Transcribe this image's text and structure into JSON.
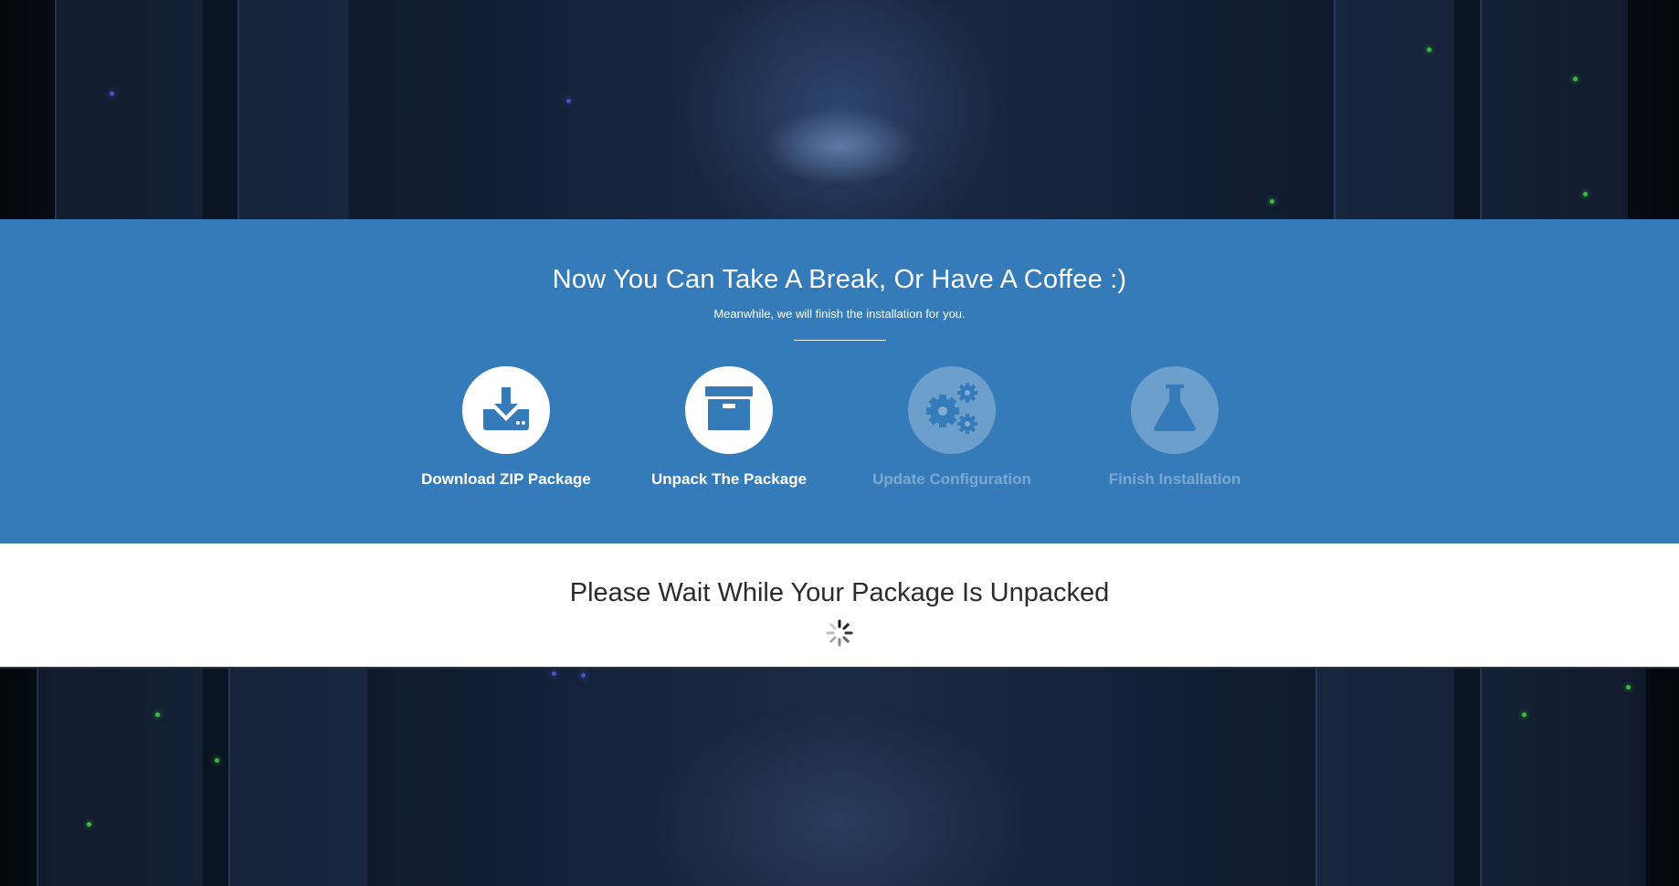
{
  "header": {
    "title": "Now You Can Take A Break, Or Have A Coffee :)",
    "subtitle": "Meanwhile, we will finish the installation for you."
  },
  "steps": [
    {
      "label": "Download ZIP Package",
      "icon": "download-icon",
      "state": "done"
    },
    {
      "label": "Unpack The Package",
      "icon": "archive-box-icon",
      "state": "active"
    },
    {
      "label": "Update Configuration",
      "icon": "gears-icon",
      "state": "pending"
    },
    {
      "label": "Finish Installation",
      "icon": "flask-icon",
      "state": "pending"
    }
  ],
  "status": {
    "message": "Please Wait While Your Package Is Unpacked",
    "indicator": "loading-spinner-icon"
  },
  "colors": {
    "band": "#357ab9",
    "active_icon": "#357ab9",
    "inactive_circle": "rgba(255,255,255,0.28)",
    "status_text": "#2b2b2b"
  }
}
